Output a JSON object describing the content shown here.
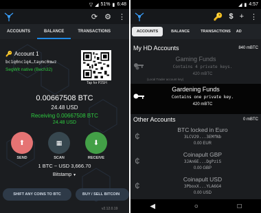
{
  "left": {
    "status": {
      "battery": "51%",
      "time": "6:48"
    },
    "tabs": [
      "ACCOUNTS",
      "BALANCE",
      "TRANSACTIONS"
    ],
    "account_name": "Account 1",
    "address": "bc1q0nc1q4…taymc0mwz",
    "address_type": "SegWit native (Bech32)",
    "qr_label": "Tap for P2SH",
    "balance_btc": "0.00667508 BTC",
    "balance_usd": "24.48 USD",
    "receiving_btc": "Receiving 0.00667508 BTC",
    "receiving_usd": "24.48 USD",
    "actions": [
      {
        "label": "SEND",
        "icon": "upload-icon",
        "color": "#e57373"
      },
      {
        "label": "SCAN",
        "icon": "qr-scan-icon",
        "color": "#37474f"
      },
      {
        "label": "RECEIVE",
        "icon": "download-icon",
        "color": "#43a047"
      }
    ],
    "rate": "1 BTC ~ USD 3,666.70",
    "source": "Bitstamp",
    "buttons": [
      "SHIFT ANY COINS TO BTC",
      "BUY / SELL BITCOIN"
    ],
    "version": "v2.12.0.19"
  },
  "right": {
    "status": {
      "time": "4:57"
    },
    "tabs": [
      "ACCOUNTS",
      "BALANCE",
      "TRANSACTIONS",
      "AD"
    ],
    "hd_header": "My HD Accounts",
    "hd_total": "840 mBTC",
    "hd_accounts": [
      {
        "name": "Gaming Funds",
        "desc": "Contains 4 private keys.",
        "balance": "420 mBTC",
        "sub": "(Local Trader account key)",
        "selected": false
      },
      {
        "name": "Gardening Funds",
        "desc": "Contains one private key.",
        "balance": "420 mBTC",
        "sub": "",
        "selected": true
      }
    ],
    "other_header": "Other Accounts",
    "other_total": "0 mBTC",
    "other_accounts": [
      {
        "name": "BTC locked in Euro",
        "address": "3LCV29...3EMfNb",
        "balance": "0.00 EUR"
      },
      {
        "name": "Coinapult GBP",
        "address": "3JAn6E...DgPziS",
        "balance": "0.00 GBP"
      },
      {
        "name": "Coinapult USD",
        "address": "3PboxX...YLA6G4",
        "balance": "0.00 USD"
      }
    ]
  }
}
